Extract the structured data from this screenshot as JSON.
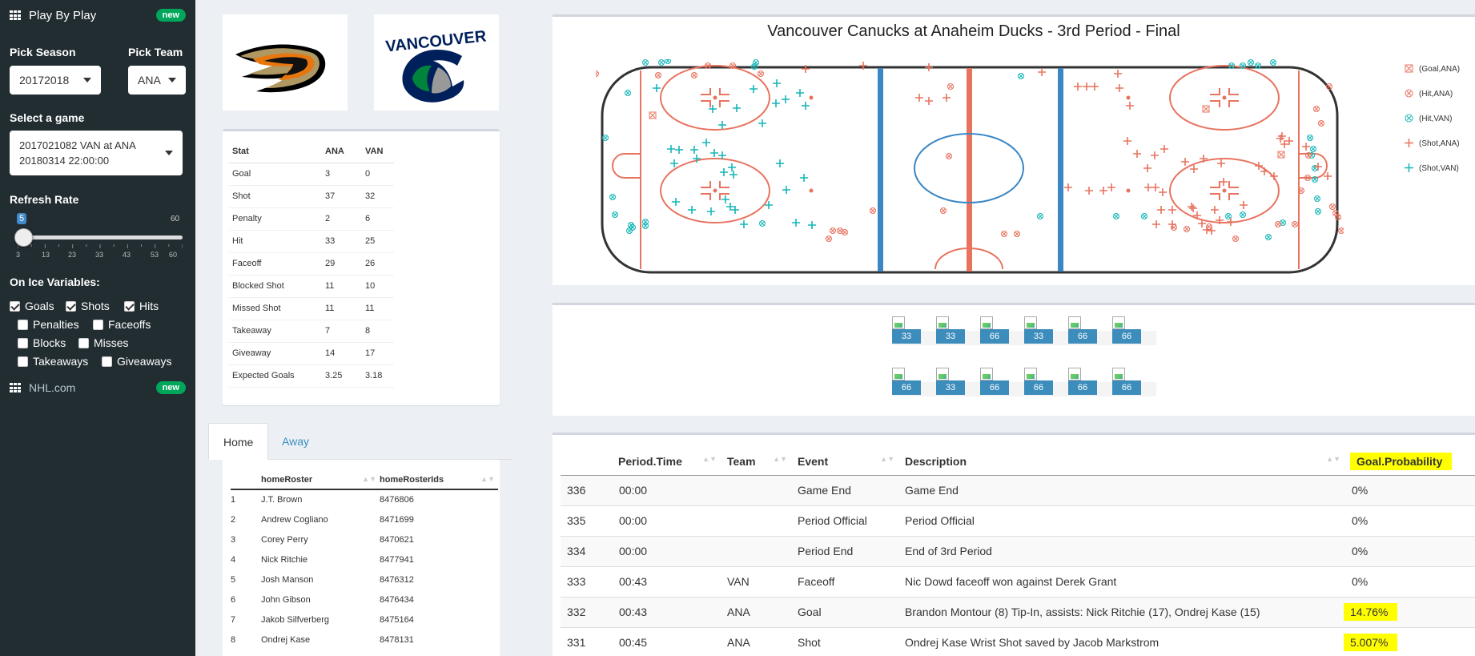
{
  "sidebar": {
    "menu_title": "Play By Play",
    "menu_badge": "new",
    "season_label": "Pick Season",
    "season_value": "20172018",
    "team_label": "Pick Team",
    "team_value": "ANA",
    "game_label": "Select a game",
    "game_value_line1": "2017021082 VAN at ANA",
    "game_value_line2": "20180314 22:00:00",
    "refresh_label": "Refresh Rate",
    "refresh_value": "5",
    "refresh_max": "60",
    "refresh_ticks": [
      "3",
      "13",
      "23",
      "33",
      "43",
      "53",
      "60"
    ],
    "on_ice_label": "On Ice Variables:",
    "checkboxes": [
      {
        "label": "Goals",
        "checked": true
      },
      {
        "label": "Shots",
        "checked": true
      },
      {
        "label": "Hits",
        "checked": true
      },
      {
        "label": "Penalties",
        "checked": false
      },
      {
        "label": "Faceoffs",
        "checked": false
      },
      {
        "label": "Blocks",
        "checked": false
      },
      {
        "label": "Misses",
        "checked": false
      },
      {
        "label": "Takeaways",
        "checked": false
      },
      {
        "label": "Giveaways",
        "checked": false
      }
    ],
    "nhl_link": "NHL.com",
    "nhl_badge": "new"
  },
  "logos": {
    "home_team_text": "VANCOUVER"
  },
  "stats": {
    "headers": [
      "Stat",
      "ANA",
      "VAN"
    ],
    "rows": [
      [
        "Goal",
        "3",
        "0"
      ],
      [
        "Shot",
        "37",
        "32"
      ],
      [
        "Penalty",
        "2",
        "6"
      ],
      [
        "Hit",
        "33",
        "25"
      ],
      [
        "Faceoff",
        "29",
        "26"
      ],
      [
        "Blocked Shot",
        "11",
        "10"
      ],
      [
        "Missed Shot",
        "11",
        "11"
      ],
      [
        "Takeaway",
        "7",
        "8"
      ],
      [
        "Giveaway",
        "14",
        "17"
      ],
      [
        "Expected Goals",
        "3.25",
        "3.18"
      ]
    ]
  },
  "tabs": {
    "home": "Home",
    "away": "Away"
  },
  "roster": {
    "headers": [
      "",
      "homeRoster",
      "homeRosterIds"
    ],
    "rows": [
      [
        "1",
        "J.T. Brown",
        "8476806"
      ],
      [
        "2",
        "Andrew Cogliano",
        "8471699"
      ],
      [
        "3",
        "Corey Perry",
        "8470621"
      ],
      [
        "4",
        "Nick Ritchie",
        "8477941"
      ],
      [
        "5",
        "Josh Manson",
        "8476312"
      ],
      [
        "6",
        "John Gibson",
        "8476434"
      ],
      [
        "7",
        "Jakob Silfverberg",
        "8475164"
      ],
      [
        "8",
        "Ondrej Kase",
        "8478131"
      ]
    ]
  },
  "rink": {
    "title": "Vancouver Canucks at Anaheim Ducks - 3rd Period - Final",
    "legend": [
      {
        "label": "(Goal,ANA)",
        "color": "#e8735f",
        "marker": "square-x"
      },
      {
        "label": "(Hit,ANA)",
        "color": "#e8735f",
        "marker": "circle-x"
      },
      {
        "label": "(Hit,VAN)",
        "color": "#16b6b8",
        "marker": "circle-x"
      },
      {
        "label": "(Shot,ANA)",
        "color": "#e8735f",
        "marker": "plus"
      },
      {
        "label": "(Shot,VAN)",
        "color": "#16b6b8",
        "marker": "plus"
      }
    ]
  },
  "players_row1": [
    "33",
    "33",
    "66",
    "33",
    "66",
    "66"
  ],
  "players_row2": [
    "66",
    "33",
    "66",
    "66",
    "66",
    "66"
  ],
  "events": {
    "headers": [
      "",
      "Period.Time",
      "Team",
      "Event",
      "Description",
      "Goal.Probability"
    ],
    "rows": [
      [
        "336",
        "00:00",
        "",
        "Game End",
        "Game End",
        "0%"
      ],
      [
        "335",
        "00:00",
        "",
        "Period Official",
        "Period Official",
        "0%"
      ],
      [
        "334",
        "00:00",
        "",
        "Period End",
        "End of 3rd Period",
        "0%"
      ],
      [
        "333",
        "00:43",
        "VAN",
        "Faceoff",
        "Nic Dowd faceoff won against Derek Grant",
        "0%"
      ],
      [
        "332",
        "00:43",
        "ANA",
        "Goal",
        "Brandon Montour (8) Tip-In, assists: Nick Ritchie (17), Ondrej Kase (15)",
        "14.76%"
      ],
      [
        "331",
        "00:45",
        "ANA",
        "Shot",
        "Ondrej Kase Wrist Shot saved by Jacob Markstrom",
        "5.007%"
      ]
    ]
  }
}
